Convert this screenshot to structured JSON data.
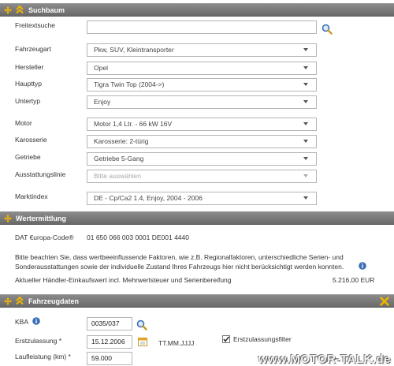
{
  "colors": {
    "header_bg": "#7a7a7a",
    "accent_yellow": "#f0b400",
    "link_blue": "#3b6fb6"
  },
  "suchbaum": {
    "title": "Suchbaum",
    "freitext_label": "Freitextsuche",
    "freitext_value": "",
    "rows": [
      {
        "label": "Fahrzeugart",
        "value": "Pkw, SUV, Kleintransporter",
        "disabled": false
      },
      {
        "label": "Hersteller",
        "value": "Opel",
        "disabled": false
      },
      {
        "label": "Haupttyp",
        "value": "Tigra Twin Top (2004->)",
        "disabled": false
      },
      {
        "label": "Untertyp",
        "value": "Enjoy",
        "disabled": false
      },
      {
        "label": "Motor",
        "value": "Motor 1,4 Ltr. - 66 kW 16V",
        "disabled": false
      },
      {
        "label": "Karosserie",
        "value": "Karosserie: 2-türig",
        "disabled": false
      },
      {
        "label": "Getriebe",
        "value": "Getriebe 5-Gang",
        "disabled": false
      },
      {
        "label": "Ausstattungslinie",
        "value": "Bitte auswählen",
        "disabled": true
      },
      {
        "label": "Marktindex",
        "value": "DE - Cp/Ca2 1.4, Enjoy, 2004 - 2006",
        "disabled": false
      }
    ]
  },
  "wertermittlung": {
    "title": "Wertermittlung",
    "dat_label": "DAT €uropa-Code®",
    "dat_code": "01 650 066 003 0001 DE001 4440",
    "note_line1": "Bitte beachten Sie, dass wertbeeinflussende Faktoren, wie z.B. Regionalfaktoren, unterschiedliche Serien- und",
    "note_line2": "Sonderausstattungen sowie der individuelle Zustand Ihres Fahrzeugs hier nicht berücksichtigt werden konnten.",
    "price_label": "Aktueller Händler-Einkaufswert incl. Mehrwertsteuer und Serienbereifung",
    "price_value": "5.216,00 EUR"
  },
  "fahrzeugdaten": {
    "title": "Fahrzeugdaten",
    "kba_label": "KBA",
    "kba_value": "0035/037",
    "erstzulassung_label": "Erstzulassung *",
    "erstzulassung_value": "15.12.2006",
    "date_format": "TT.MM.JJJJ",
    "filter_label": "Erstzulassungsfilter",
    "filter_checked": true,
    "laufleistung_label": "Laufleistung (km) *",
    "laufleistung_value": "59.000"
  },
  "watermark": "www.MOTOR-TALK.de"
}
